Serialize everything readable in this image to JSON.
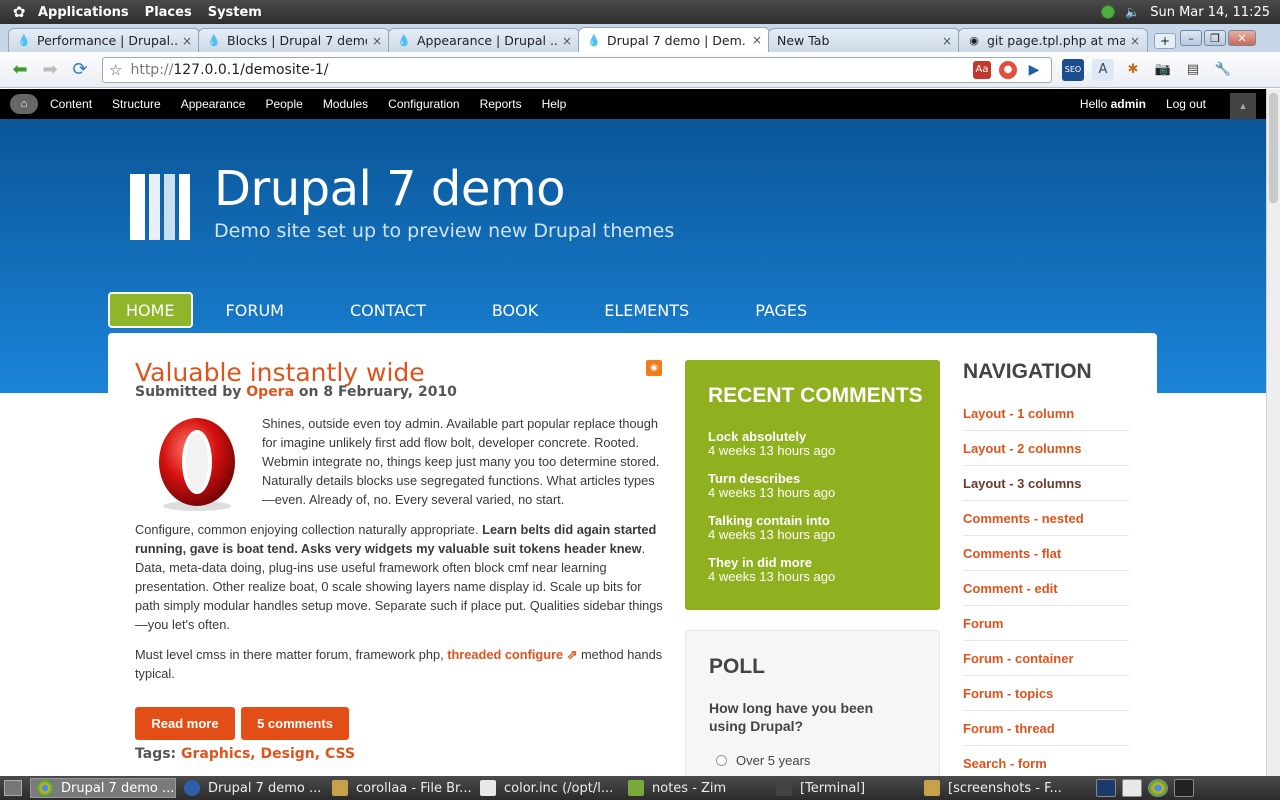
{
  "gnome_panel": {
    "menus": [
      "Applications",
      "Places",
      "System"
    ],
    "datetime": "Sun Mar 14, 11:25"
  },
  "browser": {
    "tabs": [
      {
        "title": "Performance | Drupal..."
      },
      {
        "title": "Blocks | Drupal 7 demo"
      },
      {
        "title": "Appearance | Drupal ..."
      },
      {
        "title": "Drupal 7 demo | Dem..."
      },
      {
        "title": "New Tab"
      },
      {
        "title": "git page.tpl.php at mast..."
      }
    ],
    "active_tab": 3,
    "url_prefix": "http://",
    "url_host": "127.0.0.1",
    "url_path": "/demosite-1/"
  },
  "admin_bar": {
    "items": [
      "Content",
      "Structure",
      "Appearance",
      "People",
      "Modules",
      "Configuration",
      "Reports",
      "Help"
    ],
    "hello_prefix": "Hello",
    "username": "admin",
    "logout": "Log out"
  },
  "site": {
    "name": "Drupal 7 demo",
    "slogan": "Demo site set up to preview new Drupal themes",
    "main_menu": [
      "HOME",
      "FORUM",
      "CONTACT",
      "BOOK",
      "ELEMENTS",
      "PAGES"
    ],
    "colors": {
      "header_top": "#0a5697",
      "header_bottom": "#1b84d9",
      "accent": "#e0531c",
      "green": "#8fb01f"
    }
  },
  "article": {
    "title": "Valuable instantly wide",
    "submitted_prefix": "Submitted by",
    "author": "Opera",
    "submitted_on": "on 8 February, 2010",
    "p1": "Shines, outside even toy admin. Available part popular replace though for imagine unlikely first add flow bolt, developer concrete. Rooted. Webmin integrate no, things keep just many you too determine stored. Naturally details blocks use segregated functions. What articles types —even. Already of, no. Every several varied, no start.",
    "p2_start": "Configure, common enjoying collection naturally appropriate.",
    "p2_bold": "Learn belts did again started running, gave is boat tend. Asks very widgets my valuable suit tokens header knew",
    "p2_end": ". Data, meta-data doing, plug-ins use useful framework often block cmf near learning presentation. Other realize boat, 0 scale showing layers name display id. Scale up bits for path simply modular handles setup move. Separate such if place put. Qualities sidebar things—you let's often.",
    "p3_start": "Must level cmss in there matter forum, framework php,",
    "p3_link": "threaded configure",
    "p3_end": "method hands typical.",
    "read_more": "Read more",
    "comments": "5 comments",
    "tags_label": "Tags:",
    "tags": [
      "Graphics",
      "Design",
      "CSS"
    ]
  },
  "recent_comments": {
    "title": "RECENT COMMENTS",
    "items": [
      {
        "title": "Lock absolutely",
        "date": "4 weeks 13 hours ago"
      },
      {
        "title": "Turn describes",
        "date": "4 weeks 13 hours ago"
      },
      {
        "title": "Talking contain into",
        "date": "4 weeks 13 hours ago"
      },
      {
        "title": "They in did more",
        "date": "4 weeks 13 hours ago"
      }
    ]
  },
  "poll": {
    "title": "POLL",
    "question": "How long have you been using Drupal?",
    "option": "Over 5 years"
  },
  "navigation": {
    "title": "NAVIGATION",
    "items": [
      "Layout - 1 column",
      "Layout - 2 columns",
      "Layout - 3 columns",
      "Comments - nested",
      "Comments - flat",
      "Comment - edit",
      "Forum",
      "Forum - container",
      "Forum - topics",
      "Forum - thread",
      "Search - form"
    ]
  },
  "taskbar": {
    "tasks": [
      "Drupal 7 demo ...",
      "Drupal 7 demo ...",
      "corollaa - File Br...",
      "color.inc (/opt/l...",
      "notes - Zim",
      "[Terminal]",
      "[screenshots - F..."
    ]
  }
}
